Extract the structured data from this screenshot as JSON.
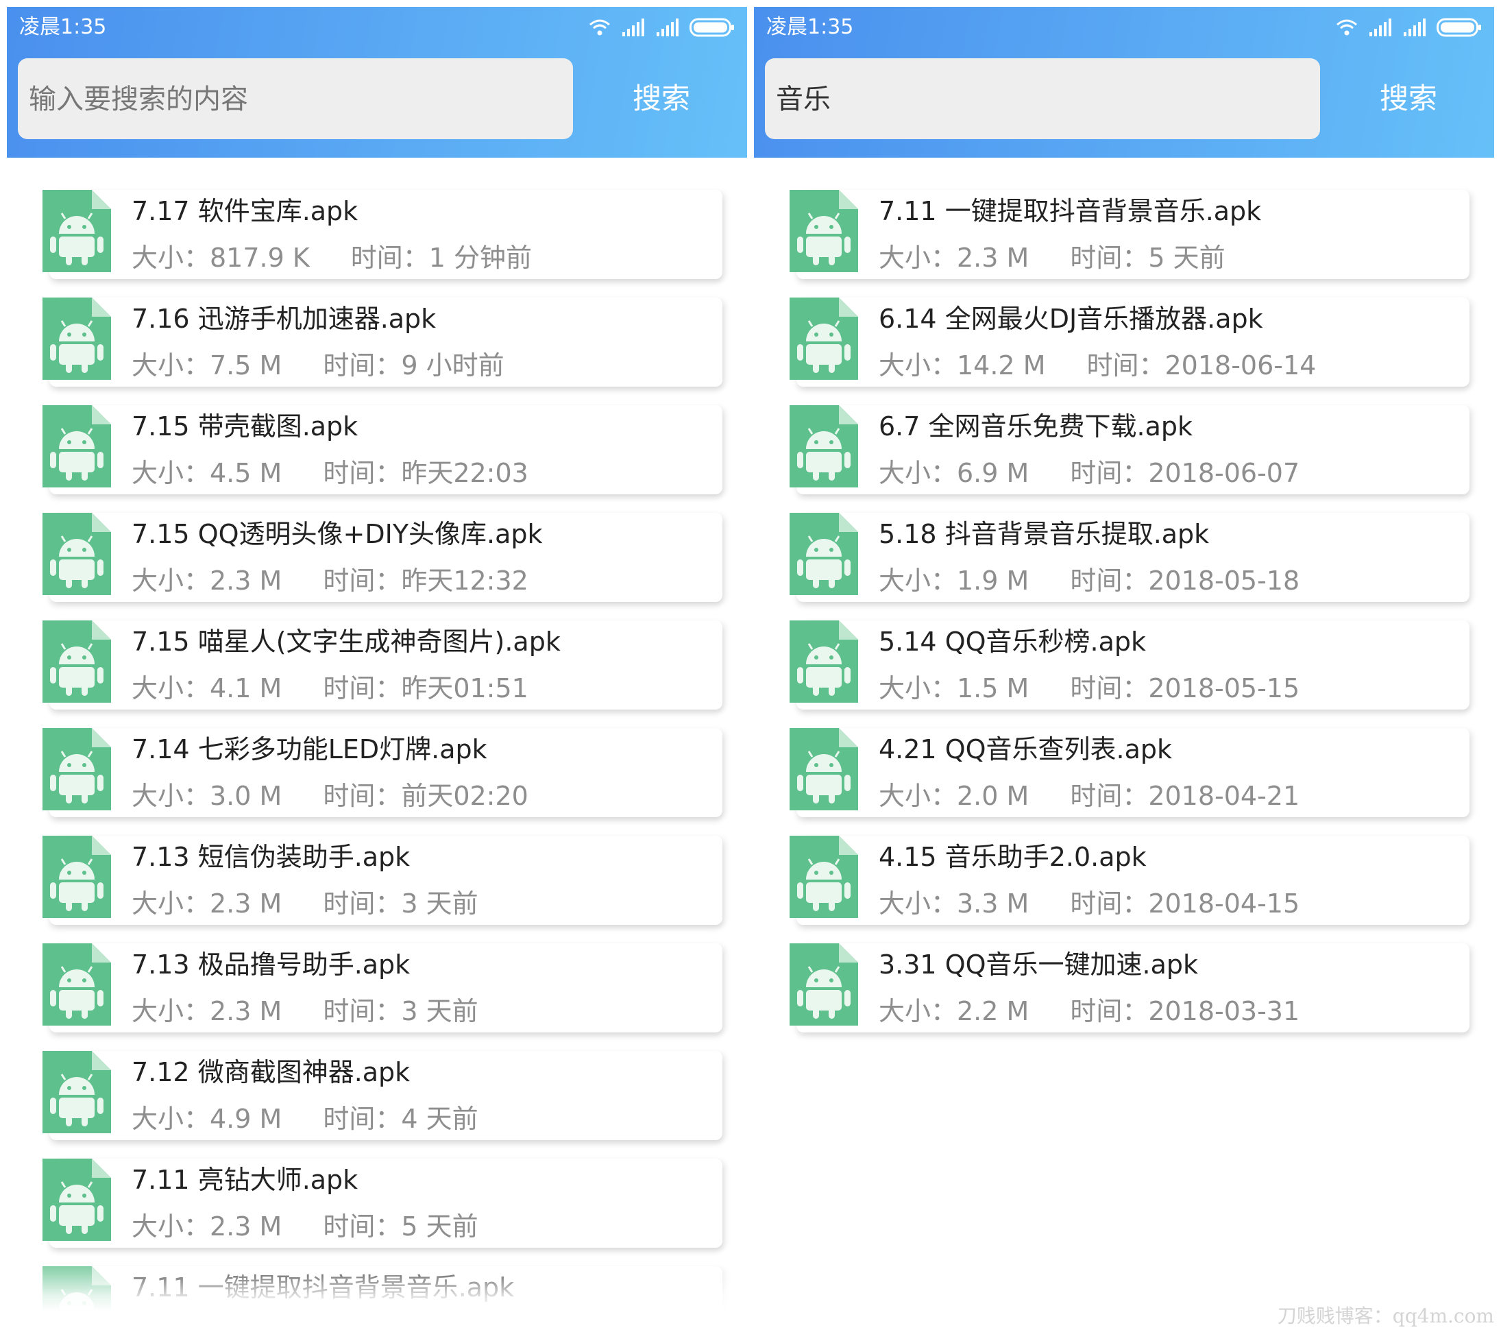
{
  "colors": {
    "header_gradient_start": "#4a90ee",
    "header_gradient_end": "#66c0f8",
    "file_icon_green": "#5ec08c",
    "meta_text": "#8e8e8e"
  },
  "left": {
    "status": {
      "time": "凌晨1:35"
    },
    "search": {
      "placeholder": "输入要搜索的内容",
      "value": "",
      "button_label": "搜索"
    },
    "items": [
      {
        "name": "7.17 软件宝库.apk",
        "size": "大小：817.9 K",
        "time": "时间：1 分钟前"
      },
      {
        "name": "7.16 迅游手机加速器.apk",
        "size": "大小：7.5 M",
        "time": "时间：9 小时前"
      },
      {
        "name": "7.15 带壳截图.apk",
        "size": "大小：4.5 M",
        "time": "时间：昨天22:03"
      },
      {
        "name": "7.15 QQ透明头像+DIY头像库.apk",
        "size": "大小：2.3 M",
        "time": "时间：昨天12:32"
      },
      {
        "name": "7.15 喵星人(文字生成神奇图片).apk",
        "size": "大小：4.1 M",
        "time": "时间：昨天01:51"
      },
      {
        "name": "7.14 七彩多功能LED灯牌.apk",
        "size": "大小：3.0 M",
        "time": "时间：前天02:20"
      },
      {
        "name": "7.13 短信伪装助手.apk",
        "size": "大小：2.3 M",
        "time": "时间：3 天前"
      },
      {
        "name": "7.13 极品撸号助手.apk",
        "size": "大小：2.3 M",
        "time": "时间：3 天前"
      },
      {
        "name": "7.12 微商截图神器.apk",
        "size": "大小：4.9 M",
        "time": "时间：4 天前"
      },
      {
        "name": "7.11 亮钻大师.apk",
        "size": "大小：2.3 M",
        "time": "时间：5 天前"
      },
      {
        "name": "7.11 一键提取抖音背景音乐.apk",
        "size": "",
        "time": ""
      }
    ]
  },
  "right": {
    "status": {
      "time": "凌晨1:35"
    },
    "search": {
      "placeholder": "",
      "value": "音乐",
      "button_label": "搜索"
    },
    "items": [
      {
        "name": "7.11 一键提取抖音背景音乐.apk",
        "size": "大小：2.3 M",
        "time": "时间：5 天前"
      },
      {
        "name": "6.14 全网最火DJ音乐播放器.apk",
        "size": "大小：14.2 M",
        "time": "时间：2018-06-14"
      },
      {
        "name": "6.7 全网音乐免费下载.apk",
        "size": "大小：6.9 M",
        "time": "时间：2018-06-07"
      },
      {
        "name": "5.18 抖音背景音乐提取.apk",
        "size": "大小：1.9 M",
        "time": "时间：2018-05-18"
      },
      {
        "name": "5.14 QQ音乐秒榜.apk",
        "size": "大小：1.5 M",
        "time": "时间：2018-05-15"
      },
      {
        "name": "4.21 QQ音乐查列表.apk",
        "size": "大小：2.0 M",
        "time": "时间：2018-04-21"
      },
      {
        "name": "4.15 音乐助手2.0.apk",
        "size": "大小：3.3 M",
        "time": "时间：2018-04-15"
      },
      {
        "name": "3.31 QQ音乐一键加速.apk",
        "size": "大小：2.2 M",
        "time": "时间：2018-03-31"
      }
    ]
  },
  "watermark": "刀贱贱博客：qq4m.com"
}
